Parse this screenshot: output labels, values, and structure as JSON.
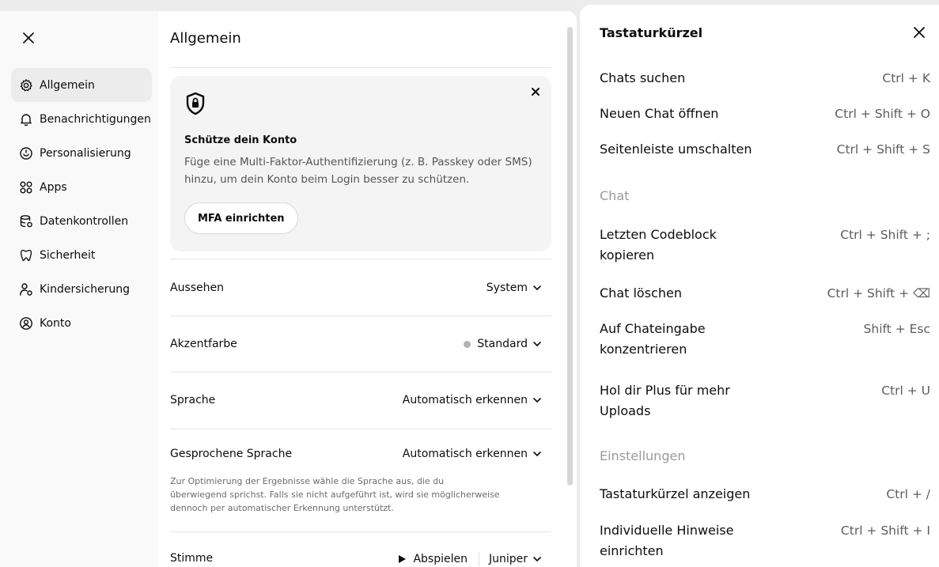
{
  "settings": {
    "nav": [
      {
        "label": "Allgemein",
        "icon": "gear-icon",
        "active": true
      },
      {
        "label": "Benachrichtigungen",
        "icon": "bell-icon"
      },
      {
        "label": "Personalisierung",
        "icon": "personalization-icon"
      },
      {
        "label": "Apps",
        "icon": "apps-grid-icon"
      },
      {
        "label": "Datenkontrollen",
        "icon": "database-gear-icon"
      },
      {
        "label": "Sicherheit",
        "icon": "security-icon"
      },
      {
        "label": "Kindersicherung",
        "icon": "parental-control-icon"
      },
      {
        "label": "Konto",
        "icon": "account-icon"
      }
    ],
    "page_title": "Allgemein",
    "mfa_card": {
      "heading": "Schütze dein Konto",
      "text": "Füge eine Multi-Faktor-Authentifizierung (z. B. Passkey oder SMS) hinzu, um dein Konto beim Login besser zu schützen.",
      "button_label": "MFA einrichten"
    },
    "rows": {
      "appearance": {
        "label": "Aussehen",
        "value": "System"
      },
      "accent": {
        "label": "Akzentfarbe",
        "value": "Standard",
        "dot_color": "#b4b4b4"
      },
      "language": {
        "label": "Sprache",
        "value": "Automatisch erkennen"
      },
      "spoken_language": {
        "label": "Gesprochene Sprache",
        "value": "Automatisch erkennen",
        "hint": "Zur Optimierung der Ergebnisse wähle die Sprache aus, die du überwiegend sprichst. Falls sie nicht aufgeführt ist, wird sie möglicherweise dennoch per automatischer Erkennung unterstützt."
      },
      "voice": {
        "label": "Stimme",
        "play_label": "Abspielen",
        "value": "Juniper"
      }
    }
  },
  "shortcuts": {
    "title": "Tastaturkürzel",
    "items": [
      {
        "label": "Chats suchen",
        "keys": "Ctrl + K"
      },
      {
        "label": "Neuen Chat öffnen",
        "keys": "Ctrl + Shift + O"
      },
      {
        "label": "Seitenleiste umschalten",
        "keys": "Ctrl + Shift + S"
      }
    ],
    "section_chat": "Chat",
    "chat_items": [
      {
        "label": "Letzten Codeblock kopieren",
        "keys": "Ctrl + Shift + ;"
      },
      {
        "label": "Chat löschen",
        "keys": "Ctrl + Shift + ⌫"
      },
      {
        "label": "Auf Chateingabe konzentrieren",
        "keys": "Shift + Esc"
      },
      {
        "label": "Hol dir Plus für mehr Uploads",
        "keys": "Ctrl + U"
      }
    ],
    "section_settings": "Einstellungen",
    "settings_items": [
      {
        "label": "Tastaturkürzel anzeigen",
        "keys": "Ctrl + /"
      },
      {
        "label": "Individuelle Hinweise einrichten",
        "keys": "Ctrl + Shift + I"
      }
    ]
  }
}
